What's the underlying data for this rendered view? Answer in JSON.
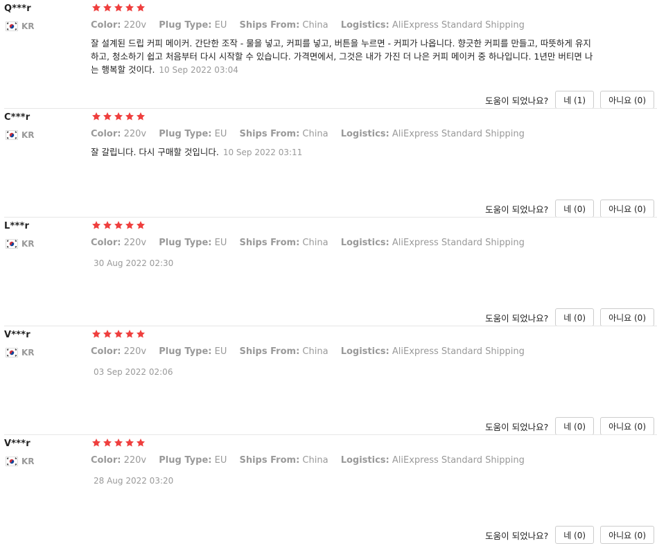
{
  "labels": {
    "color": "Color:",
    "plug_type": "Plug Type:",
    "ships_from": "Ships From:",
    "logistics": "Logistics:",
    "helpful_question": "도움이 되었나요?"
  },
  "colors": {
    "star": "#ef3f3e",
    "muted_text": "#999999",
    "body_text": "#222222",
    "separator": "#e6e6e6",
    "button_border": "#cccccc"
  },
  "reviews": [
    {
      "user": "Q***r",
      "country": "KR",
      "flag_icon": "flag-kr-icon",
      "rating": 5,
      "color": "220v",
      "plug_type": "EU",
      "ships_from": "China",
      "logistics": "AliExpress Standard Shipping",
      "text": "잘 설계된 드립 커피 메이커. 간단한 조작 - 물을 넣고, 커피를 넣고, 버튼을 누르면 - 커피가 나옵니다. 향긋한 커피를 만들고, 따뜻하게 유지하고, 청소하기 쉽고 처음부터 다시 시작할 수 있습니다. 가격면에서, 그것은 내가 가진 더 나은 커피 메이커 중 하나입니다. 1년만 버티면 나는 행복할 것이다.",
      "date": "10 Sep 2022 03:04",
      "helpful_yes": "네 (1)",
      "helpful_no": "아니요 (0)"
    },
    {
      "user": "C***r",
      "country": "KR",
      "flag_icon": "flag-kr-icon",
      "rating": 5,
      "color": "220v",
      "plug_type": "EU",
      "ships_from": "China",
      "logistics": "AliExpress Standard Shipping",
      "text": "잘 갈립니다. 다시 구매할 것입니다.",
      "date": "10 Sep 2022 03:11",
      "helpful_yes": "네 (0)",
      "helpful_no": "아니요 (0)"
    },
    {
      "user": "L***r",
      "country": "KR",
      "flag_icon": "flag-kr-icon",
      "rating": 5,
      "color": "220v",
      "plug_type": "EU",
      "ships_from": "China",
      "logistics": "AliExpress Standard Shipping",
      "text": "",
      "date": "30 Aug 2022 02:30",
      "helpful_yes": "네 (0)",
      "helpful_no": "아니요 (0)"
    },
    {
      "user": "V***r",
      "country": "KR",
      "flag_icon": "flag-kr-icon",
      "rating": 5,
      "color": "220v",
      "plug_type": "EU",
      "ships_from": "China",
      "logistics": "AliExpress Standard Shipping",
      "text": "",
      "date": "03 Sep 2022 02:06",
      "helpful_yes": "네 (0)",
      "helpful_no": "아니요 (0)"
    },
    {
      "user": "V***r",
      "country": "KR",
      "flag_icon": "flag-kr-icon",
      "rating": 5,
      "color": "220v",
      "plug_type": "EU",
      "ships_from": "China",
      "logistics": "AliExpress Standard Shipping",
      "text": "",
      "date": "28 Aug 2022 03:20",
      "helpful_yes": "네 (0)",
      "helpful_no": "아니요 (0)"
    }
  ]
}
